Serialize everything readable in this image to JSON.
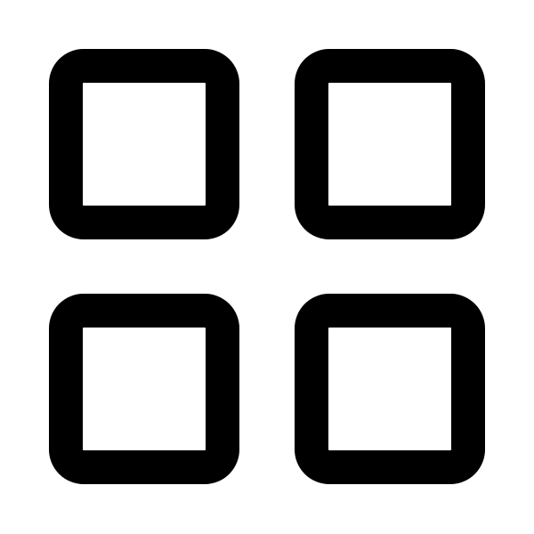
{
  "icon": {
    "name": "grid-icon",
    "stroke_color": "#000000",
    "background_color": "#ffffff",
    "tiles": [
      "top-left",
      "top-right",
      "bottom-left",
      "bottom-right"
    ]
  }
}
